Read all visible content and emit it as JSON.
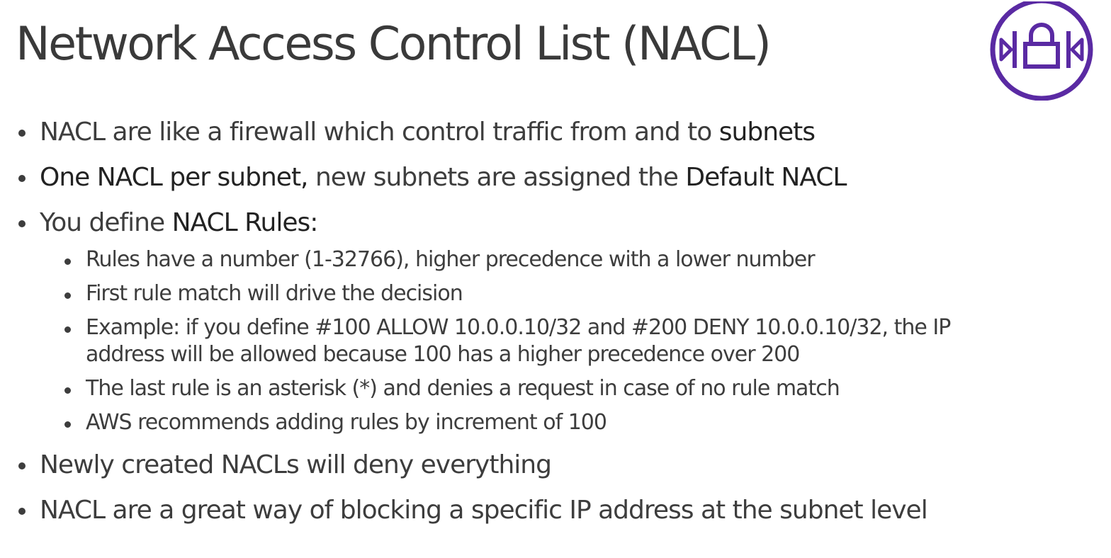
{
  "slide": {
    "title": "Network Access Control List (NACL)",
    "logo_icon": "nacl-lock-icon",
    "accent_color": "#5a2aa3"
  },
  "bullets": [
    {
      "parts": [
        "NACL are like a firewall which control traffic from and to ",
        "subnets"
      ]
    },
    {
      "parts": [
        "One NACL per subnet,",
        " new subnets are assigned the ",
        "Default NACL"
      ]
    },
    {
      "parts": [
        "You define ",
        "NACL Rules:"
      ],
      "sub": [
        "Rules have a number (1-32766), higher precedence with a lower number",
        "First rule match will drive the decision",
        "Example: if you define #100 ALLOW 10.0.0.10/32 and #200 DENY 10.0.0.10/32, the IP",
        "address will be allowed because 100 has a higher precedence over 200",
        "The last rule is an asterisk (*) and denies a request in case of no rule match",
        "AWS recommends adding rules by increment of 100"
      ]
    },
    {
      "parts": [
        "Newly created NACLs will deny everything"
      ]
    },
    {
      "parts": [
        "NACL are a great way of blocking a specific IP address at the subnet level"
      ]
    }
  ]
}
